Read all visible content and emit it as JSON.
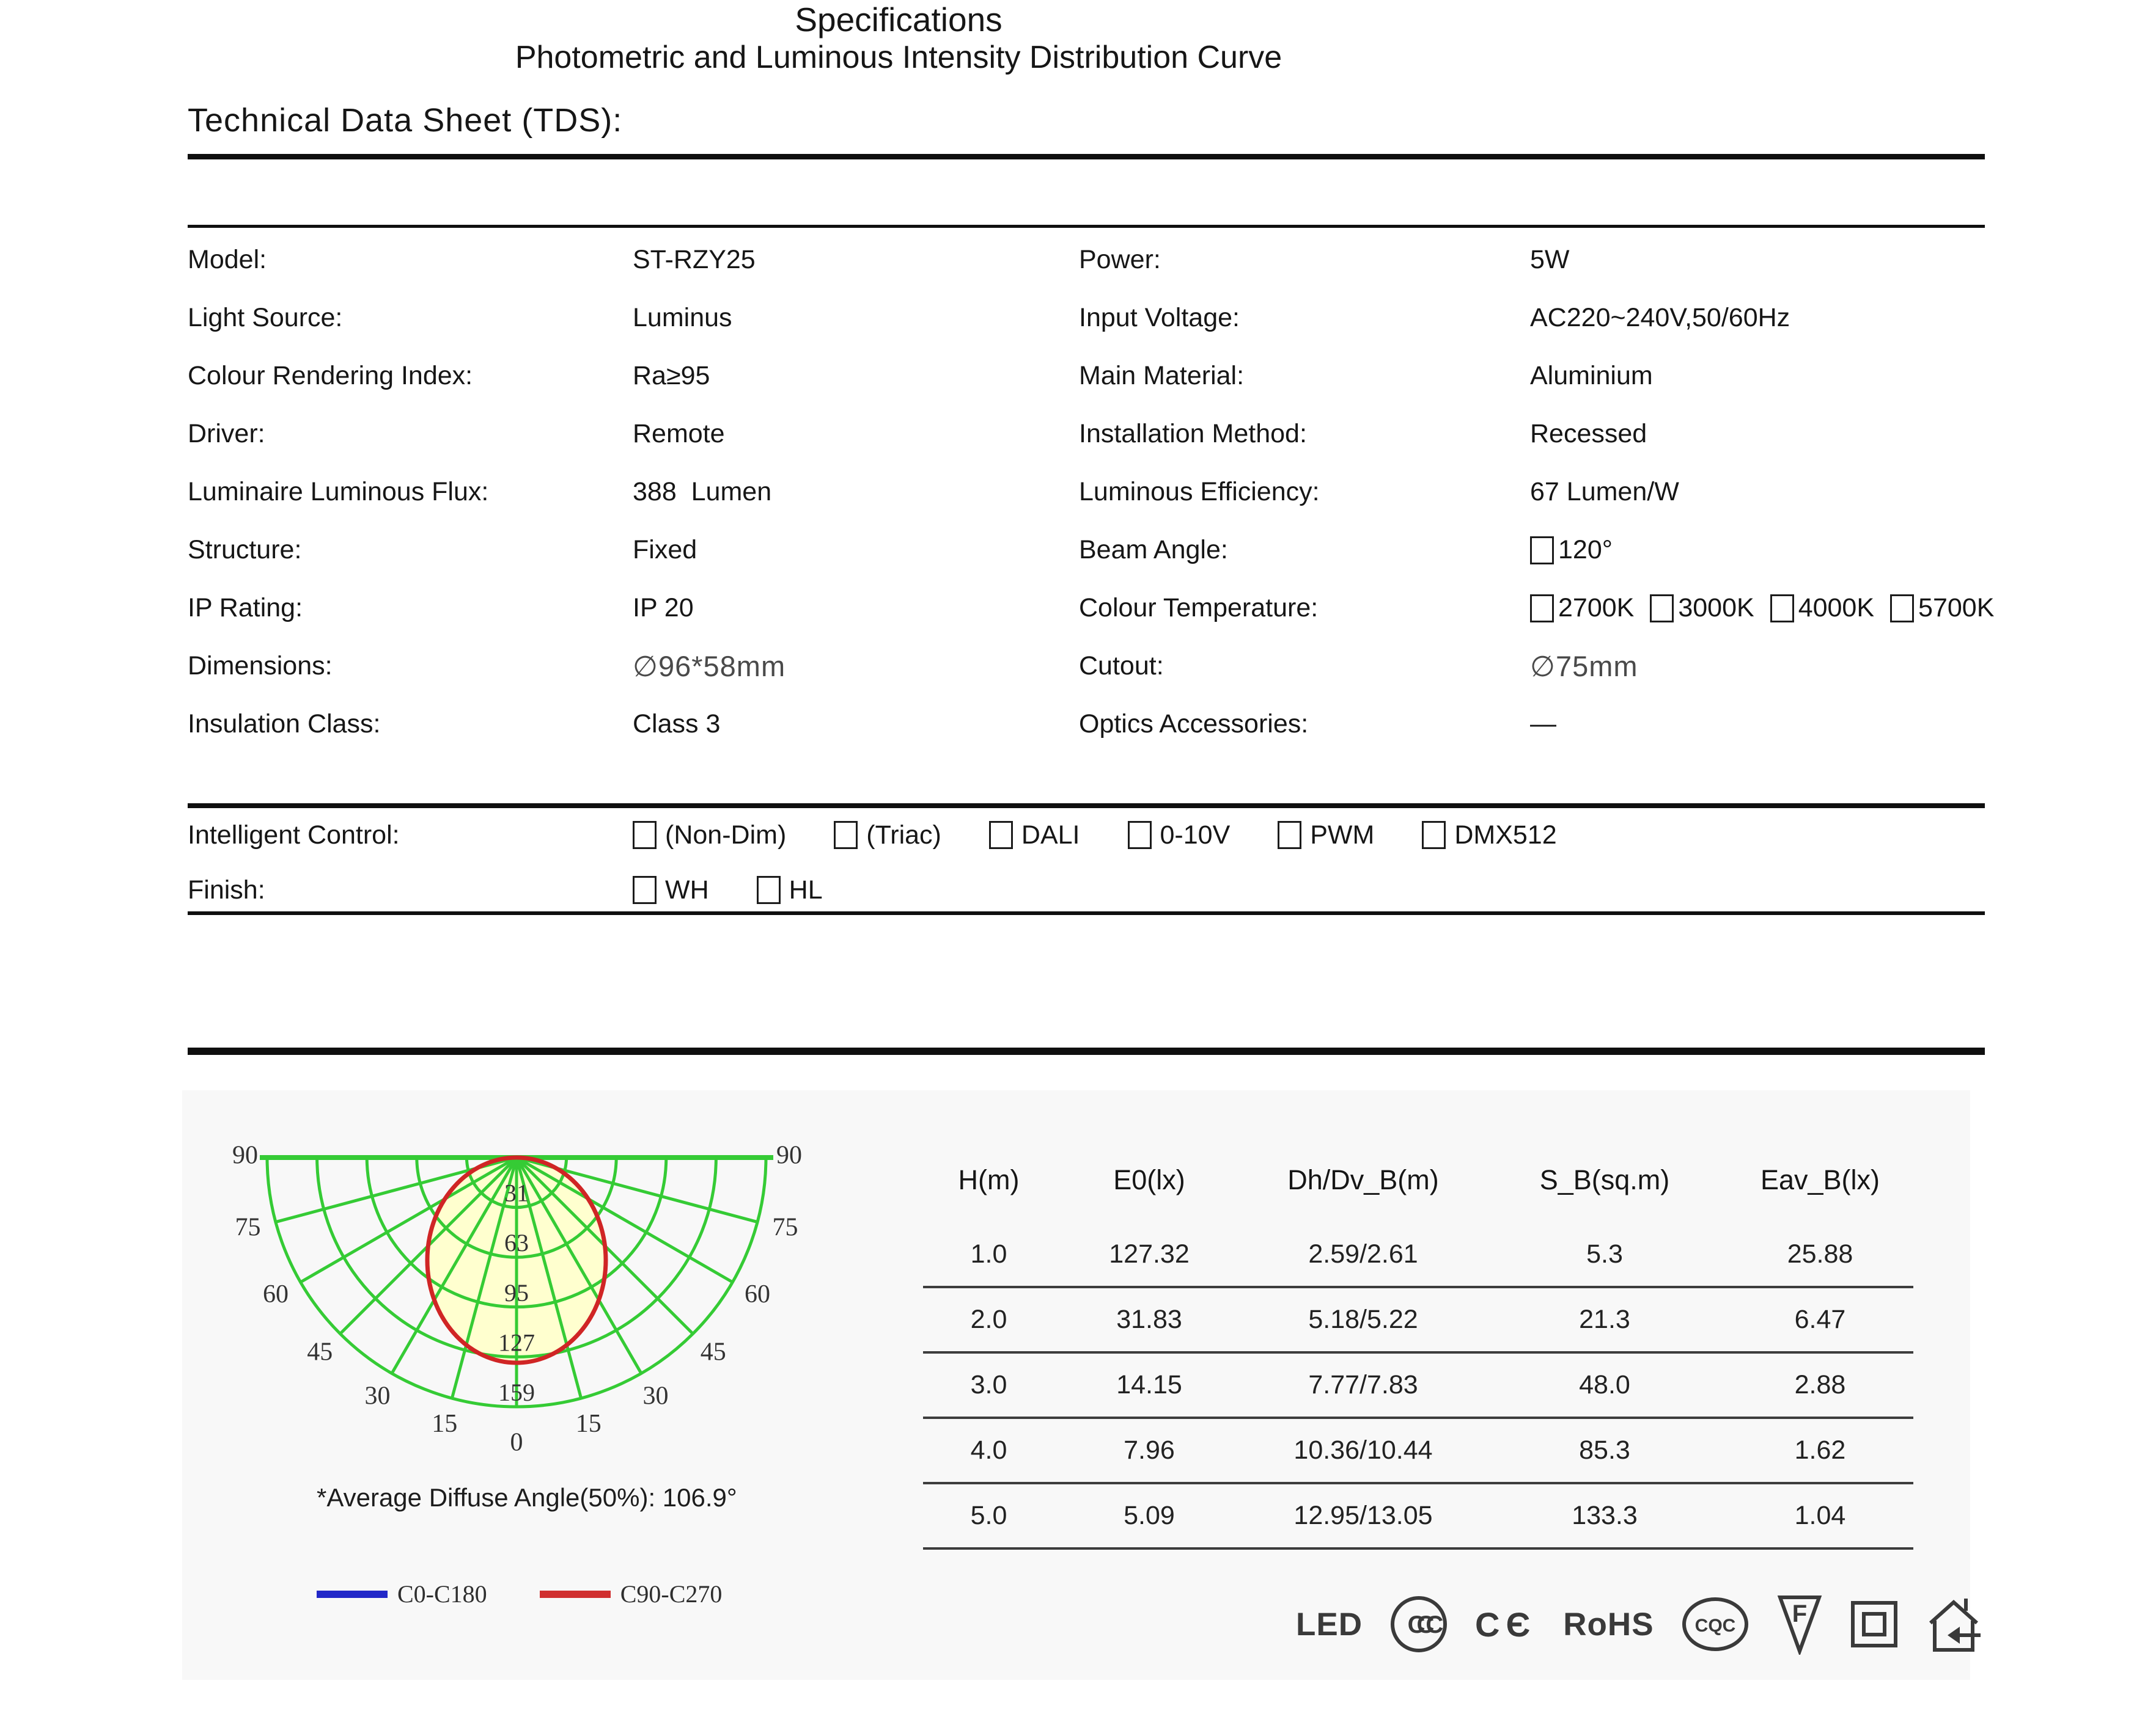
{
  "title": "Technical Data Sheet (TDS):",
  "specifications": {
    "heading": "Specifications",
    "left": [
      {
        "label": "Model:",
        "value": "ST-RZY25"
      },
      {
        "label": "Light Source:",
        "value": "Luminus"
      },
      {
        "label": "Colour Rendering Index:",
        "value": "Ra≥95"
      },
      {
        "label": "Driver:",
        "value": "Remote"
      },
      {
        "label": "Luminaire Luminous Flux:",
        "value": "388  Lumen"
      },
      {
        "label": "Structure:",
        "value": "Fixed"
      },
      {
        "label": "IP Rating:",
        "value": "IP 20"
      },
      {
        "label": "Dimensions:",
        "value": "∅96*58mm",
        "muted": true
      },
      {
        "label": "Insulation Class:",
        "value": "Class 3"
      }
    ],
    "right": [
      {
        "label": "Power:",
        "value": "5W"
      },
      {
        "label": "Input Voltage:",
        "value": "AC220~240V,50/60Hz"
      },
      {
        "label": "Main Material:",
        "value": "Aluminium"
      },
      {
        "label": "Installation Method:",
        "value": "Recessed"
      },
      {
        "label": "Luminous Efficiency:",
        "value": "67 Lumen/W"
      },
      {
        "label": "Beam Angle:",
        "checkboxes": [
          {
            "label": "120°",
            "checked": false
          }
        ]
      },
      {
        "label": "Colour Temperature:",
        "checkboxes": [
          {
            "label": "2700K",
            "checked": false
          },
          {
            "label": "3000K",
            "checked": false
          },
          {
            "label": "4000K",
            "checked": false
          },
          {
            "label": "5700K",
            "checked": false
          }
        ]
      },
      {
        "label": "Cutout:",
        "value": "∅75mm",
        "muted": true
      },
      {
        "label": "Optics Accessories:",
        "value": "—"
      }
    ]
  },
  "controls": [
    {
      "label": "Intelligent Control:",
      "checkboxes": [
        {
          "label": "(Non-Dim)",
          "checked": false
        },
        {
          "label": "(Triac)",
          "checked": false
        },
        {
          "label": "DALI",
          "checked": false
        },
        {
          "label": "0-10V",
          "checked": false
        },
        {
          "label": "PWM",
          "checked": false
        },
        {
          "label": "DMX512",
          "checked": false
        }
      ]
    },
    {
      "label": "Finish:",
      "checkboxes": [
        {
          "label": "WH",
          "checked": false
        },
        {
          "label": "HL",
          "checked": false
        }
      ]
    }
  ],
  "photometric": {
    "heading": "Photometric and Luminous Intensity Distribution Curve",
    "caption": "*Average Diffuse Angle(50%): 106.9°",
    "legend": [
      {
        "label": "C0-C180",
        "color": "#2228c8"
      },
      {
        "label": "C90-C270",
        "color": "#d03030"
      }
    ],
    "chart": {
      "type": "polar-photometric",
      "angle_ticks": [
        0,
        15,
        30,
        45,
        60,
        75,
        90
      ],
      "ring_labels": [
        "31",
        "63",
        "95",
        "127",
        "159"
      ],
      "grid_color": "#35cb35",
      "beam_fill": "#ffffcf",
      "beam_stroke": "#d02525",
      "average_diffuse_angle_deg": 106.9
    }
  },
  "table": {
    "headers": [
      "H(m)",
      "E0(lx)",
      "Dh/Dv_B(m)",
      "S_B(sq.m)",
      "Eav_B(lx)"
    ],
    "rows": [
      [
        "1.0",
        "127.32",
        "2.59/2.61",
        "5.3",
        "25.88"
      ],
      [
        "2.0",
        "31.83",
        "5.18/5.22",
        "21.3",
        "6.47"
      ],
      [
        "3.0",
        "14.15",
        "7.77/7.83",
        "48.0",
        "2.88"
      ],
      [
        "4.0",
        "7.96",
        "10.36/10.44",
        "85.3",
        "1.62"
      ],
      [
        "5.0",
        "5.09",
        "12.95/13.05",
        "133.3",
        "1.04"
      ]
    ]
  },
  "certifications": [
    {
      "type": "text",
      "label": "LED",
      "name": "led-mark-icon"
    },
    {
      "type": "ccc",
      "label": "CCC",
      "name": "ccc-mark-icon"
    },
    {
      "type": "ce",
      "label": "CE",
      "glyph": "CЄ",
      "name": "ce-mark-icon"
    },
    {
      "type": "text",
      "label": "RoHS",
      "name": "rohs-mark-icon"
    },
    {
      "type": "cqc",
      "label": "CQC",
      "name": "cqc-mark-icon"
    },
    {
      "type": "f",
      "label": "F",
      "name": "f-mark-icon"
    },
    {
      "type": "square",
      "name": "class-ii-icon"
    },
    {
      "type": "house",
      "name": "indoor-use-icon"
    }
  ]
}
